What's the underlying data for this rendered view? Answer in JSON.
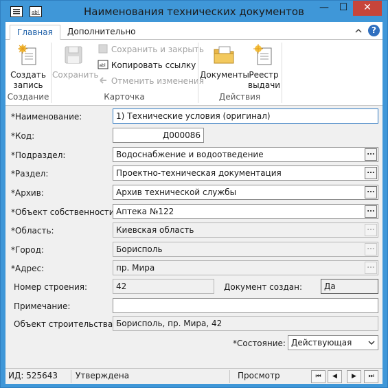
{
  "window": {
    "title": "Наименования технических документов",
    "minimize": "—",
    "maximize": "☐",
    "close": "✕"
  },
  "ribbon": {
    "tabs": [
      {
        "label": "Главная",
        "active": true
      },
      {
        "label": "Дополнительно",
        "active": false
      }
    ],
    "groups": {
      "create": {
        "title": "Создание",
        "create_record": "Создать запись"
      },
      "card": {
        "title": "Карточка",
        "save": "Сохранить",
        "save_close": "Сохранить и закрыть",
        "copy_link": "Копировать ссылку",
        "cancel_changes": "Отменить изменения"
      },
      "actions": {
        "title": "Действия",
        "documents": "Документы",
        "registry": "Реестр выдачи"
      }
    },
    "collapse_icon": "chevron-up-icon",
    "help_icon": "?"
  },
  "form": {
    "fields": {
      "name": {
        "label": "*Наименование:",
        "value": "1) Технические условия (оригинал)"
      },
      "code": {
        "label": "*Код:",
        "value": "Д000086"
      },
      "subsection": {
        "label": "*Подраздел:",
        "value": "Водоснабжение и водоотведение"
      },
      "section": {
        "label": "*Раздел:",
        "value": "Проектно-техническая документация"
      },
      "archive": {
        "label": "*Архив:",
        "value": "Архив технической службы"
      },
      "property": {
        "label": "*Объект собственности:",
        "value": "Аптека №122"
      },
      "region": {
        "label": "*Область:",
        "value": "Киевская область"
      },
      "city": {
        "label": "*Город:",
        "value": "Борисполь"
      },
      "address": {
        "label": "*Адрес:",
        "value": "пр. Мира"
      },
      "building_no": {
        "label": "Номер строения:",
        "value": "42"
      },
      "doc_created": {
        "label": "Документ создан:",
        "value": "Да"
      },
      "note": {
        "label": "Примечание:",
        "value": ""
      },
      "construction_object": {
        "label": "Объект строительства:",
        "value": "Борисполь, пр. Мира, 42"
      },
      "state": {
        "label": "*Состояние:",
        "value": "Действующая"
      }
    },
    "lookup_button": "..."
  },
  "status_bar": {
    "id": "ИД: 525643",
    "status": "Утверждена",
    "mode": "Просмотр",
    "nav": {
      "first": "⏮",
      "prev": "◀",
      "next": "▶",
      "last": "⏭"
    }
  },
  "colors": {
    "titlebar": "#3f97d8",
    "accent": "#1e60a8",
    "focus": "#2e79c2"
  }
}
